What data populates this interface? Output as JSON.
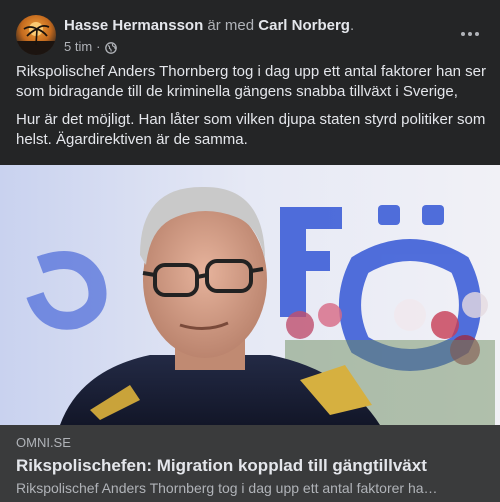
{
  "post": {
    "author": "Hasse Hermansson",
    "with_text": "är med",
    "tagged": "Carl Norberg",
    "period": ".",
    "time": "5 tim",
    "separator": "·",
    "privacy_icon": "globe-icon",
    "more_icon": "more-horizontal-icon",
    "paragraphs": [
      "Rikspolischef Anders Thornberg tog i dag upp ett antal faktorer han ser som bidragande till de kriminella gängens snabba tillväxt i Sverige,",
      "Hur är det möjligt. Han låter som vilken djupa staten styrd politiker som helst. Ägardirektiven är de samma."
    ]
  },
  "link_preview": {
    "domain": "OMNI.SE",
    "title": "Rikspolischefen: Migration kopplad till gängtillväxt",
    "description": "Rikspolischef Anders Thornberg tog i dag upp ett antal faktorer ha…",
    "image_backdrop_text": "Fö"
  },
  "colors": {
    "background": "#242526",
    "card_info": "#3a3b3c",
    "primary_text": "#e4e6eb",
    "secondary_text": "#b0b3b8",
    "backdrop_blue": "#2f55d4"
  }
}
